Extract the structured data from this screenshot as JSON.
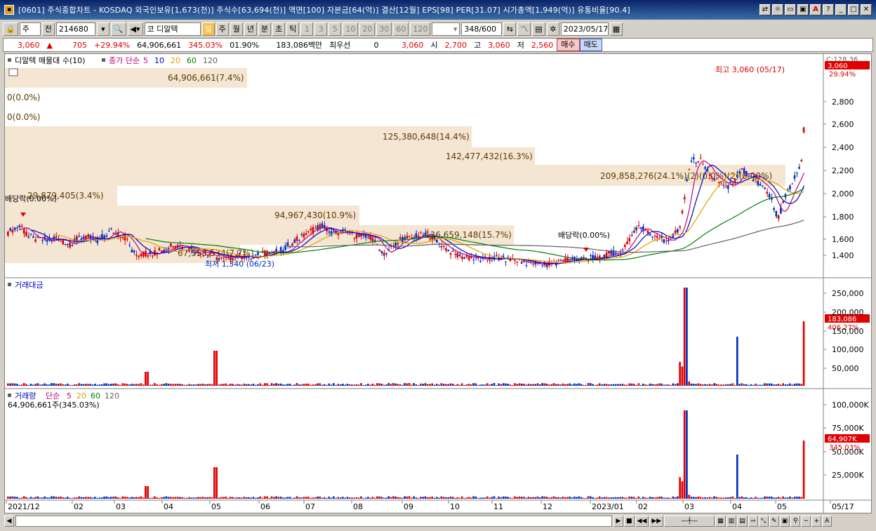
{
  "window": {
    "title": "[0601] 주식종합차트 - KOSDAQ 외국인보유[1,673(천)] 주식수[63,694(천)] 액면[100] 자본금[64(억)] 결산[12월] EPS[98] PER[31.07] 시가총액[1,949(억)] 유통비율[90.4]"
  },
  "toolbar": {
    "market": "주",
    "prev": "전",
    "code": "214680",
    "market_tag": "코",
    "stock_name": "디알텍",
    "periods": [
      "일",
      "주",
      "월",
      "년",
      "분",
      "초",
      "틱"
    ],
    "ranges": [
      "1",
      "3",
      "5",
      "10",
      "20",
      "30",
      "60",
      "120"
    ],
    "count": "348",
    "count_total": "/600",
    "date": "2023/05/17"
  },
  "quote": {
    "price": "3,060",
    "arrow": "▲",
    "change": "705",
    "change_pct": "+29.94%",
    "volume": "64,906,661",
    "volume_pct": "345.03%",
    "turnover": "01.90%",
    "amount": "183,086백만",
    "tier": "최우선",
    "zero": "0",
    "bid": "3,060",
    "open_label": "시",
    "open": "2,700",
    "high_label": "고",
    "high": "3,060",
    "low_label": "저",
    "low": "2,560",
    "buy": "매수",
    "sell": "매도"
  },
  "price_panel": {
    "legend_name": "디알텍 매물대 수(10)",
    "ma_label": "종가 단순",
    "ma_periods": [
      "5",
      "10",
      "20",
      "60",
      "120"
    ],
    "ma_colors": [
      "#c00080",
      "#0000c0",
      "#e0a000",
      "#008000",
      "#606060"
    ],
    "volume_profile": [
      "64,906,661(7.4%)",
      "0(0.0%)",
      "0(0.0%)",
      "125,380,648(14.4%)",
      "142,477,432(16.3%)",
      "209,858,276(24.1%)(2)(0.0%)(2)(0.00%)",
      "29,879,405(3.4%)",
      "94,967,430(10.9%)",
      "136,659,148(15.7%)",
      "67,555,534(7.7%)"
    ],
    "annotations": {
      "high": "최고 3,060 (05/17)",
      "low": "최저 1,340 (06/23)",
      "ex_div_left": "배당락(0.00%)",
      "ex_div_right": "배당락(0.00%)"
    },
    "price_box": "3,060",
    "pct_box": "29.94%",
    "corner": "C:128.36",
    "y_ticks": [
      "2,800",
      "2,600",
      "2,400",
      "2,200",
      "2,000",
      "1,800",
      "1,600",
      "1,400"
    ]
  },
  "amount_panel": {
    "title": "거래대금",
    "value_box": "183,086",
    "pct_box": "406.27%",
    "y_ticks": [
      "250,000",
      "200,000",
      "150,000",
      "100,000",
      "50,000"
    ]
  },
  "volume_panel": {
    "title": "거래량",
    "ma_label": "단순",
    "ma_periods": [
      "5",
      "20",
      "60",
      "120"
    ],
    "summary": "64,906,661주(345.03%)",
    "value_box": "64,907K",
    "pct_box": "345.03%",
    "y_ticks": [
      "100,000K",
      "75,000K",
      "50,000K",
      "25,000K"
    ]
  },
  "x_axis": {
    "labels": [
      "2021/12",
      "02",
      "03",
      "04",
      "05",
      "06",
      "07",
      "08",
      "09",
      "10",
      "11",
      "12",
      "2023/01",
      "02",
      "03",
      "04",
      "05",
      "05/17"
    ]
  },
  "colors": {
    "up": "#e00000",
    "down": "#0030c0",
    "profile": "#f5e6d3"
  }
}
